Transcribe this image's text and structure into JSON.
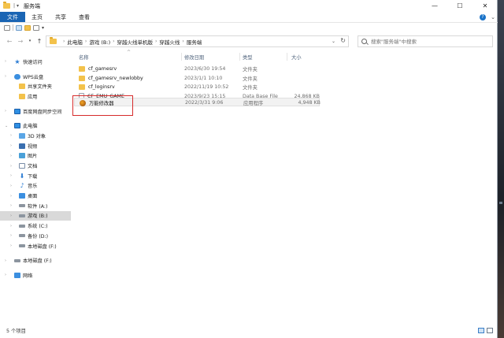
{
  "window": {
    "title": "服务端",
    "controls": {
      "minimize": "—",
      "maximize": "☐",
      "close": "✕"
    }
  },
  "ribbon": {
    "tabs": [
      "文件",
      "主页",
      "共享",
      "查看"
    ]
  },
  "address": {
    "crumbs": [
      "此电脑",
      "游戏 (B:)",
      "穿越火线单机版",
      "穿越火线",
      "服务端"
    ]
  },
  "search": {
    "placeholder": "搜索\"服务端\"中搜索"
  },
  "sidebar": {
    "items": [
      {
        "label": "快速访问",
        "icon": "star-icon"
      },
      {
        "label": "WPS云盘",
        "icon": "cloud-icon"
      },
      {
        "label": "共享文件夹",
        "icon": "folder-icon"
      },
      {
        "label": "应用",
        "icon": "folder-icon"
      },
      {
        "label": "百度网盘同步空间",
        "icon": "pc-icon"
      },
      {
        "label": "此电脑",
        "icon": "pc-icon"
      },
      {
        "label": "3D 对象",
        "icon": "cube-icon"
      },
      {
        "label": "视频",
        "icon": "video-icon"
      },
      {
        "label": "图片",
        "icon": "picture-icon"
      },
      {
        "label": "文档",
        "icon": "document-icon"
      },
      {
        "label": "下载",
        "icon": "download-icon"
      },
      {
        "label": "音乐",
        "icon": "music-icon"
      },
      {
        "label": "桌面",
        "icon": "desktop-icon"
      },
      {
        "label": "软件 (A:)",
        "icon": "drive-icon"
      },
      {
        "label": "游戏 (B:)",
        "icon": "drive-icon"
      },
      {
        "label": "系统 (C:)",
        "icon": "drive-icon"
      },
      {
        "label": "备份 (D:)",
        "icon": "drive-icon"
      },
      {
        "label": "本地磁盘 (F:)",
        "icon": "drive-icon"
      },
      {
        "label": "本地磁盘 (F:)",
        "icon": "drive-icon"
      },
      {
        "label": "网络",
        "icon": "network-icon"
      }
    ]
  },
  "columns": {
    "name": "名称",
    "date": "修改日期",
    "type": "类型",
    "size": "大小"
  },
  "files": [
    {
      "name": "cf_gamesrv",
      "date": "2023/6/30 19:54",
      "type": "文件夹",
      "size": "",
      "kind": "folder"
    },
    {
      "name": "cf_gamesrv_newlobby",
      "date": "2023/1/1 10:10",
      "type": "文件夹",
      "size": "",
      "kind": "folder"
    },
    {
      "name": "cf_loginsrv",
      "date": "2022/11/19 10:52",
      "type": "文件夹",
      "size": "",
      "kind": "folder"
    },
    {
      "name": "CF_EMU_GAME",
      "date": "2023/9/23 15:15",
      "type": "Data Base File",
      "size": "24,868 KB",
      "kind": "file"
    },
    {
      "name": "万能修改器",
      "date": "2022/3/31 9:06",
      "type": "应用程序",
      "size": "4,948 KB",
      "kind": "app"
    }
  ],
  "status": {
    "count": "5 个项目"
  }
}
